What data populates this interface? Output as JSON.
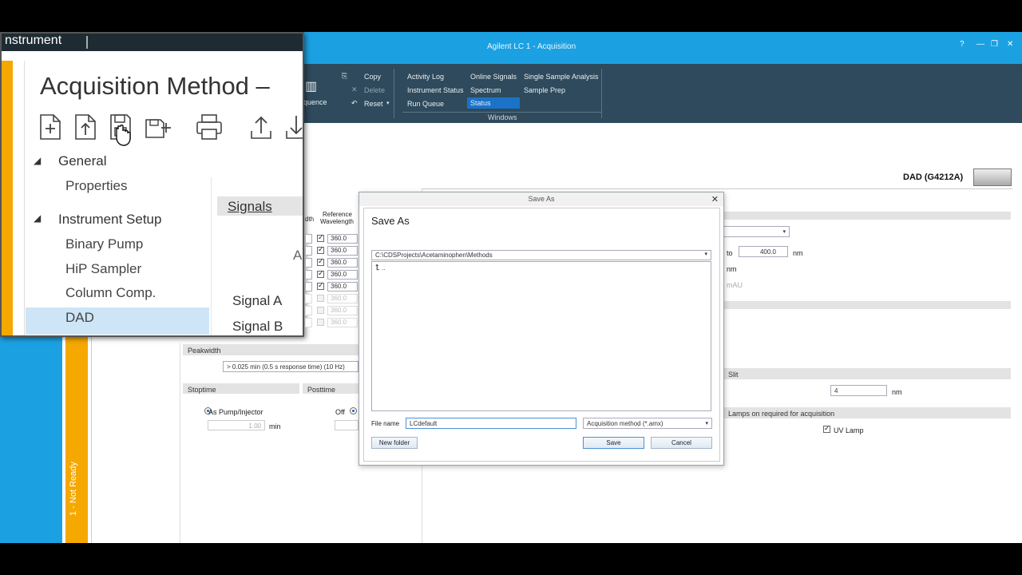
{
  "window": {
    "title": "Agilent LC 1 - Acquisition",
    "controls": [
      "?",
      "—",
      "❐",
      "✕"
    ]
  },
  "ribbon": {
    "sequence_label": "quence",
    "edit": {
      "copy": "Copy",
      "delete": "Delete",
      "reset": "Reset"
    },
    "windows_group": {
      "col1": [
        "Activity Log",
        "Instrument Status",
        "Run Queue"
      ],
      "col2": [
        "Online Signals",
        "Spectrum",
        "Status"
      ],
      "col3": [
        "Single Sample Analysis",
        "Sample Prep"
      ],
      "group_label": "Windows"
    }
  },
  "zoom_overlay": {
    "tab_title": "nstrument",
    "heading": "Acquisition Method –",
    "tree": {
      "general": "General",
      "properties": "Properties",
      "instrument_setup": "Instrument Setup",
      "binary_pump": "Binary Pump",
      "hip_sampler": "HiP Sampler",
      "column_comp": "Column Comp.",
      "dad": "DAD"
    },
    "signals_label": "Signals",
    "signal_a": "Signal A",
    "signal_b": "Signal B",
    "partial_a": "A",
    "col_width": "dth",
    "col_reference": "Reference",
    "col_wavelength": "Wavelength",
    "ref_values": [
      "360.0",
      "360.0",
      "360.0",
      "360.0",
      "360.0",
      "360.0",
      "360.0",
      "360.0"
    ]
  },
  "method_panel": {
    "device": "DAD (G4212A)",
    "peakwidth_label": "Peakwidth",
    "peakwidth_value": "> 0.025 min (0.5 s response time) (10 Hz)",
    "stoptime_label": "Stoptime",
    "stoptime_option1": "As Pump/Injector",
    "stoptime_value": "1.00",
    "stoptime_unit": "min",
    "posttime_label": "Posttime",
    "posttime_option1": "Off",
    "range_to": "to",
    "range_value": "400.0",
    "nm1": "nm",
    "nm2": "nm",
    "mau": "mAU",
    "slit_label": "Slit",
    "slit_value": "4",
    "slit_unit": "nm",
    "lamps_label": "Lamps on required for acquisition",
    "uv_lamp": "UV Lamp",
    "status": "1 - Not Ready"
  },
  "save_dialog": {
    "window_title": "Save As",
    "heading": "Save As",
    "path": "C:\\CDSProjects\\Acetaminophen\\Methods",
    "up_entry": "..",
    "file_name_label": "File name",
    "file_name_value": "LCdefault",
    "file_type": "Acquisition method (*.amx)",
    "new_folder": "New folder",
    "save": "Save",
    "cancel": "Cancel"
  }
}
